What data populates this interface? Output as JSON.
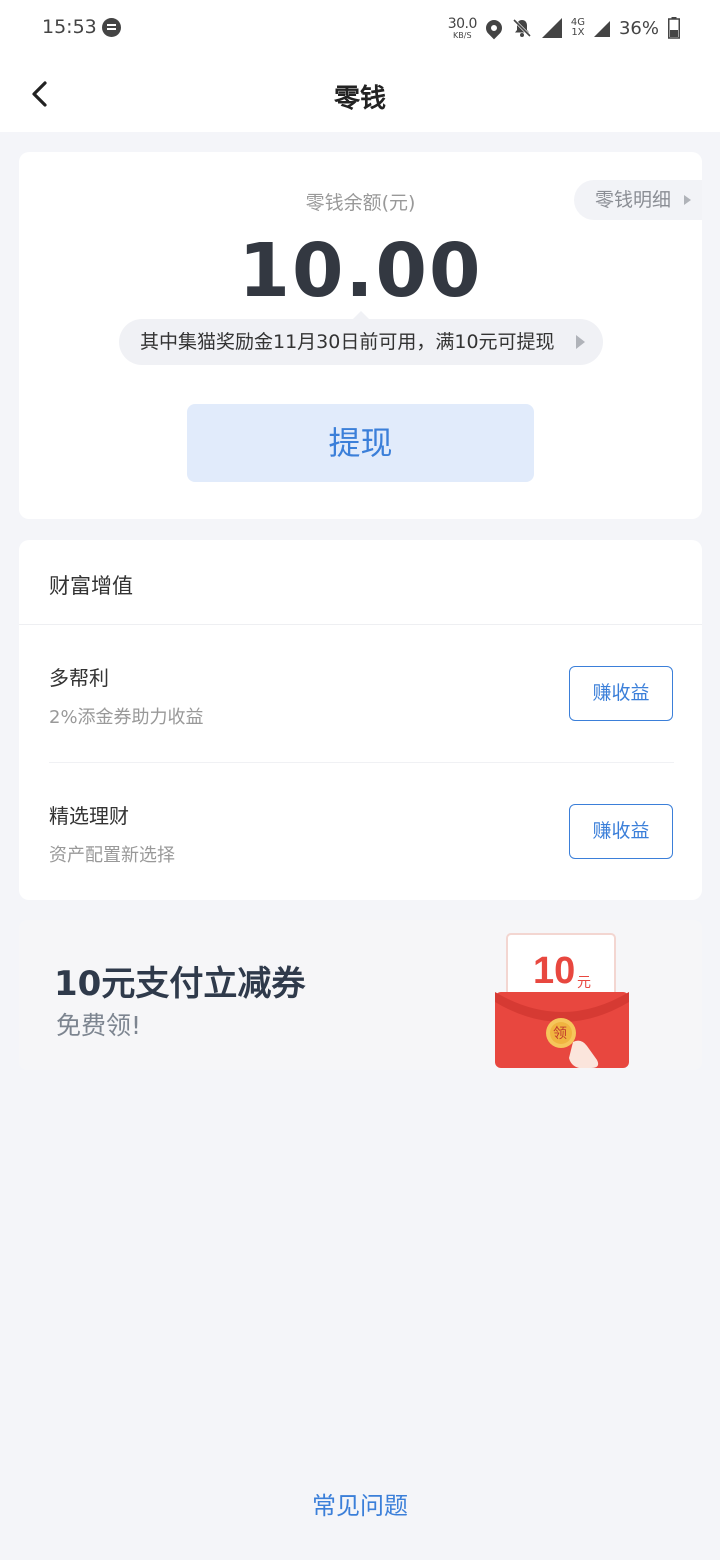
{
  "status_bar": {
    "time": "15:53",
    "net_speed": "30.0",
    "net_speed_unit": "KB/S",
    "network_top": "4G",
    "network_bottom": "1X",
    "battery": "36%"
  },
  "header": {
    "title": "零钱"
  },
  "balance": {
    "label": "零钱余额(元)",
    "detail_link": "零钱明细",
    "amount": "10.00",
    "notice": "其中集猫奖励金11月30日前可用，满10元可提现",
    "withdraw_label": "提现"
  },
  "wealth": {
    "title": "财富增值",
    "items": [
      {
        "title": "多帮利",
        "subtitle": "2%添金券助力收益",
        "button": "赚收益"
      },
      {
        "title": "精选理财",
        "subtitle": "资产配置新选择",
        "button": "赚收益"
      }
    ]
  },
  "banner": {
    "title": "10元支付立减券",
    "subtitle": "免费领!",
    "coupon_amount": "10",
    "coupon_unit": "元",
    "coupon_claim": "领"
  },
  "footer": {
    "faq": "常见问题"
  },
  "colors": {
    "accent": "#3b7fd9",
    "background": "#f4f5f9",
    "withdraw_bg": "#e1ebfb",
    "red_packet": "#e8473f"
  }
}
